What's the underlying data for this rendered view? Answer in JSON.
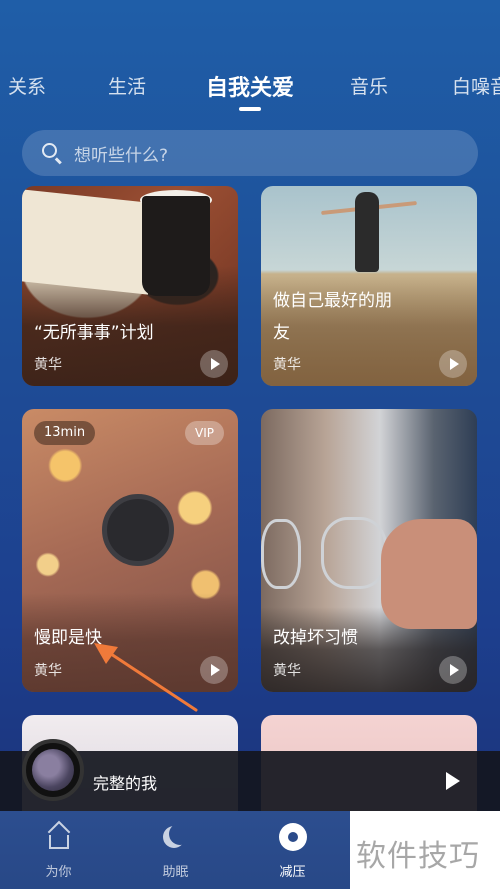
{
  "tabs": {
    "items": [
      "关系",
      "生活",
      "自我关爱",
      "音乐",
      "白噪音"
    ],
    "active": "自我关爱"
  },
  "search": {
    "placeholder": "想听些什么?"
  },
  "cards": [
    {
      "title": "“无所事事”计划",
      "author": "黄华"
    },
    {
      "title_line1": "做自己最好的朋",
      "title_line2": "友",
      "author": "黄华"
    },
    {
      "title": "慢即是快",
      "author": "黄华",
      "duration": "13min",
      "badge": "VIP"
    },
    {
      "title": "改掉坏习惯",
      "author": "黄华"
    }
  ],
  "mini_player": {
    "title": "完整的我"
  },
  "bottom_nav": {
    "items": [
      {
        "label": "为你",
        "icon": "home-icon"
      },
      {
        "label": "助眠",
        "icon": "moon-icon"
      },
      {
        "label": "减压",
        "icon": "disc-icon"
      }
    ],
    "active": "减压"
  },
  "watermark": "软件技巧",
  "colors": {
    "annotation_arrow": "#f07a3a",
    "background_top": "#1f5ea8",
    "background_bottom": "#1a2f74"
  }
}
